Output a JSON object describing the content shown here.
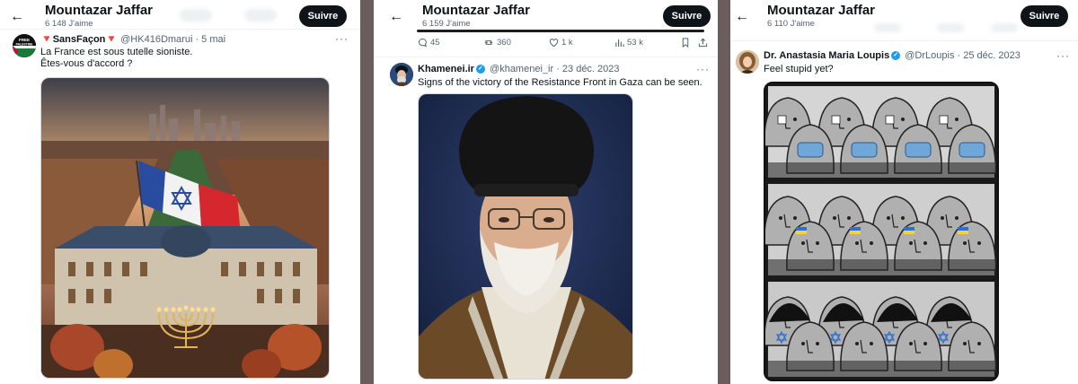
{
  "panels": [
    {
      "header": {
        "name": "Mountazar Jaffar",
        "likes": "6 148 J'aime",
        "follow": "Suivre"
      },
      "tweet": {
        "name": "🔻SansFaçon🔻",
        "handle": "@HK416Dmarui",
        "date": "· 5 mai",
        "line1": "La France est sous tutelle sioniste.",
        "line2": "Êtes-vous d'accord ?",
        "avatar_text": "FREE PALESTINE"
      }
    },
    {
      "header": {
        "name": "Mountazar Jaffar",
        "likes": "6 159 J'aime",
        "follow": "Suivre"
      },
      "actions": {
        "replies": "45",
        "reposts": "360",
        "likes": "1 k",
        "views": "53 k"
      },
      "tweet": {
        "name": "Khamenei.ir",
        "handle": "@khamenei_ir",
        "date": "· 23 déc. 2023",
        "line1": "Signs of the victory of the Resistance Front in Gaza can be seen."
      }
    },
    {
      "header": {
        "name": "Mountazar Jaffar",
        "likes": "6 110 J'aime",
        "follow": "Suivre"
      },
      "tweet": {
        "name": "Dr. Anastasia Maria Loupis",
        "handle": "@DrLoupis",
        "date": "· 25 déc. 2023",
        "line1": "Feel stupid yet?"
      }
    }
  ],
  "colors": {
    "accent": "#1d9bf0",
    "follow_bg": "#0f1419",
    "secondary_text": "#536471",
    "separator": "#6b5d5b"
  },
  "icons": [
    "back-arrow-icon",
    "more-icon",
    "verified-icon",
    "reply-icon",
    "repost-icon",
    "like-icon",
    "views-icon",
    "bookmark-icon",
    "share-icon"
  ]
}
